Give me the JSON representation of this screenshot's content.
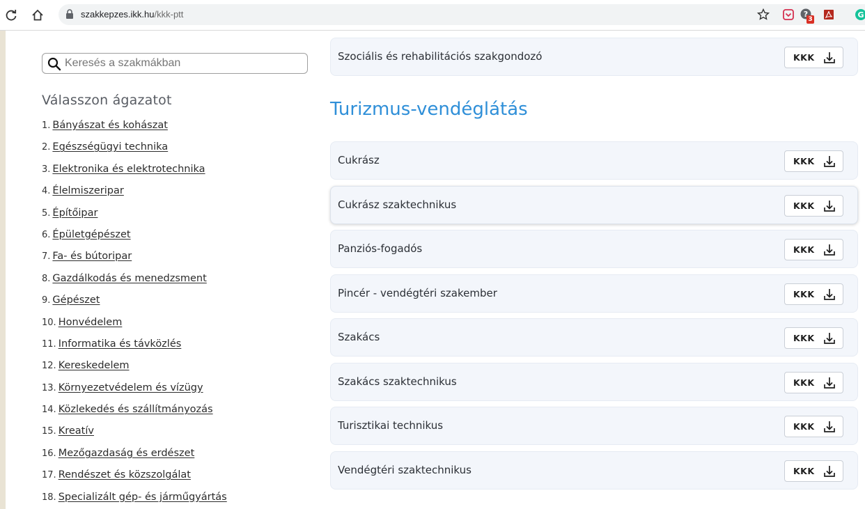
{
  "browser": {
    "url_host": "szakkepzes.ikk.hu",
    "url_path": "/kkk-ptt",
    "badge_count": "3"
  },
  "sidebar": {
    "search_placeholder": "Keresés a szakmákban",
    "heading": "Válasszon ágazatot",
    "sectors": [
      {
        "num": "1.",
        "label": "Bányászat és kohászat"
      },
      {
        "num": "2.",
        "label": "Egészségügyi technika"
      },
      {
        "num": "3.",
        "label": "Elektronika és elektrotechnika"
      },
      {
        "num": "4.",
        "label": "Élelmiszeripar"
      },
      {
        "num": "5.",
        "label": "Építőipar"
      },
      {
        "num": "6.",
        "label": "Épületgépészet"
      },
      {
        "num": "7.",
        "label": "Fa- és bútoripar"
      },
      {
        "num": "8.",
        "label": "Gazdálkodás és menedzsment"
      },
      {
        "num": "9.",
        "label": "Gépészet"
      },
      {
        "num": "10.",
        "label": "Honvédelem"
      },
      {
        "num": "11.",
        "label": "Informatika és távközlés"
      },
      {
        "num": "12.",
        "label": "Kereskedelem"
      },
      {
        "num": "13.",
        "label": "Környezetvédelem és vízügy"
      },
      {
        "num": "14.",
        "label": "Közlekedés és szállítmányozás"
      },
      {
        "num": "15.",
        "label": "Kreatív"
      },
      {
        "num": "16.",
        "label": "Mezőgazdaság és erdészet"
      },
      {
        "num": "17.",
        "label": "Rendészet és közszolgálat"
      },
      {
        "num": "18.",
        "label": "Specializált gép- és járműgyártás"
      }
    ]
  },
  "main": {
    "prev_row": {
      "label": "Szociális és rehabilitációs szakgondozó",
      "button": "KKK"
    },
    "section_title": "Turizmus-vendéglátás",
    "rows": [
      {
        "label": "Cukrász",
        "button": "KKK"
      },
      {
        "label": "Cukrász szaktechnikus",
        "button": "KKK"
      },
      {
        "label": "Panziós-fogadós",
        "button": "KKK"
      },
      {
        "label": "Pincér - vendégtéri szakember",
        "button": "KKK"
      },
      {
        "label": "Szakács",
        "button": "KKK"
      },
      {
        "label": "Szakács szaktechnikus",
        "button": "KKK"
      },
      {
        "label": "Turisztikai technikus",
        "button": "KKK"
      },
      {
        "label": "Vendégtéri szaktechnikus",
        "button": "KKK"
      }
    ]
  },
  "colors": {
    "accent": "#2f8fd8",
    "row_bg": "#f3f6fb",
    "frame": "#e9e3d4"
  }
}
